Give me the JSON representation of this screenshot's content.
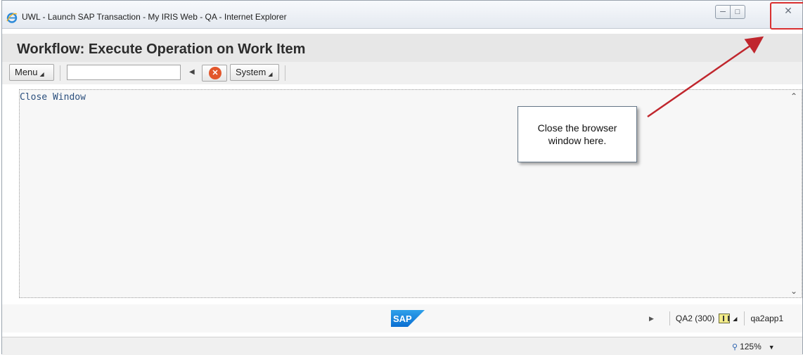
{
  "window": {
    "title": "UWL - Launch SAP Transaction - My IRIS Web - QA - Internet Explorer",
    "minimize_glyph": "▭",
    "maximize_glyph": "□",
    "close_glyph": "☒"
  },
  "sap": {
    "page_title": "Workflow: Execute Operation on Work Item",
    "toolbar": {
      "menu_label": "Menu",
      "command_value": "",
      "system_label": "System"
    },
    "content": {
      "link_text": "Close Window"
    },
    "status": {
      "system": "QA2 (300)",
      "server": "qa2app1"
    }
  },
  "callout": {
    "text_line1": "Close the browser",
    "text_line2": "window here."
  },
  "ie_status": {
    "zoom": "125%"
  },
  "colors": {
    "title_bg": "#e7e7e7",
    "callout_arrow": "#c0262d",
    "highlight_box": "#d93030",
    "sap_blue": "#0a6ed1"
  },
  "icons": [
    "ie-logo-icon",
    "cancel-icon",
    "sap-logo",
    "status-display-icon",
    "zoom-magnifier-icon"
  ]
}
